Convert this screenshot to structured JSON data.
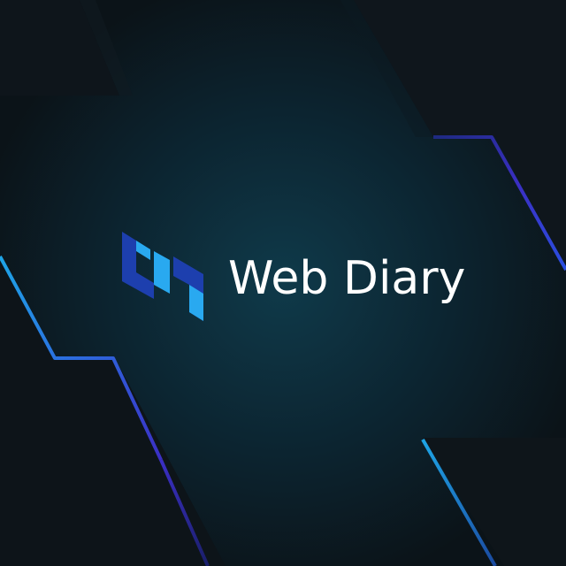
{
  "brand": {
    "name": "Web Diary",
    "logo_icon": "web-diary-logo-icon"
  },
  "colors": {
    "background_dark": "#0b1116",
    "background_glow": "#0f3a4a",
    "accent_cyan": "#1ea5e6",
    "accent_indigo": "#3b2fc4",
    "logo_light": "#29a9f0",
    "logo_dark": "#1d3fae",
    "text": "#ffffff"
  }
}
